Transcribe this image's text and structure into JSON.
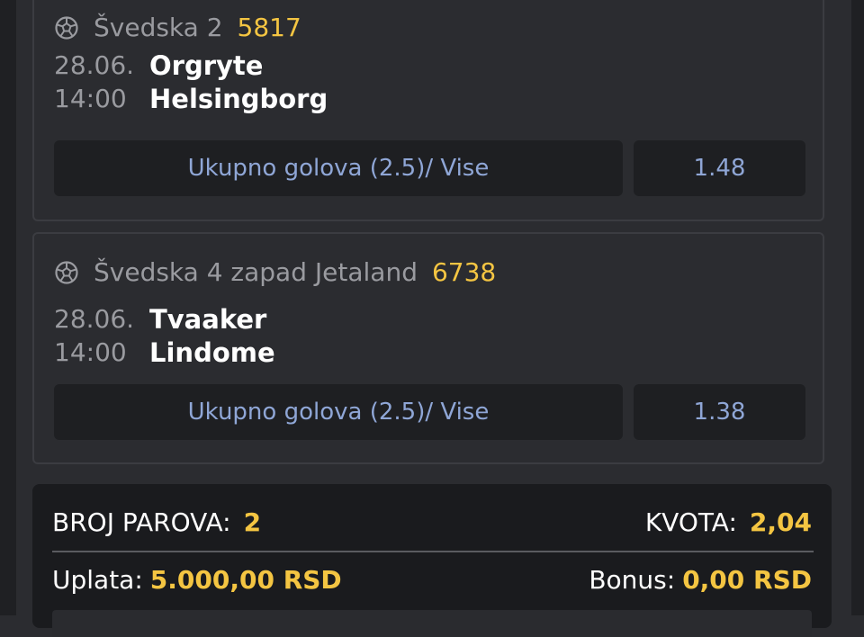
{
  "matches": [
    {
      "league": "Švedska 2",
      "code": "5817",
      "date": "28.06.",
      "time": "14:00",
      "home": "Orgryte",
      "away": "Helsingborg",
      "pick": "Ukupno golova (2.5)/ Vise",
      "odd": "1.48"
    },
    {
      "league": "Švedska 4 zapad Jetaland",
      "code": "6738",
      "date": "28.06.",
      "time": "14:00",
      "home": "Tvaaker",
      "away": "Lindome",
      "pick": "Ukupno golova (2.5)/ Vise",
      "odd": "1.38"
    }
  ],
  "summary": {
    "pairs_label": "BROJ PAROVA:",
    "pairs_value": "2",
    "odds_label": "KVOTA:",
    "odds_value": "2,04",
    "stake_label": "Uplata:",
    "stake_value": "5.000,00 RSD",
    "bonus_label": "Bonus:",
    "bonus_value": "0,00 RSD"
  },
  "icons": {
    "sport": "soccer-ball-icon"
  },
  "colors": {
    "accent": "#f4c542",
    "pick_text": "#8fa6d6",
    "background": "#2b2c30"
  }
}
